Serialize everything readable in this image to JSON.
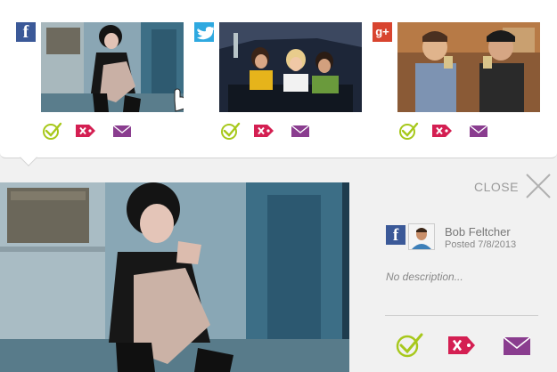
{
  "colors": {
    "accept": "#a7c81b",
    "reject": "#d41f52",
    "email": "#8a3d8f",
    "facebook": "#3b5998",
    "twitter": "#2fa9e0",
    "google_plus": "#d8442f"
  },
  "posts": [
    {
      "network_icon": "facebook-icon",
      "network_glyph": "f",
      "actions": [
        "check-icon",
        "reject-tag-icon",
        "mail-icon"
      ]
    },
    {
      "network_icon": "twitter-icon",
      "network_glyph": "t",
      "actions": [
        "check-icon",
        "reject-tag-icon",
        "mail-icon"
      ]
    },
    {
      "network_icon": "google-plus-icon",
      "network_glyph": "g+",
      "actions": [
        "check-icon",
        "reject-tag-icon",
        "mail-icon"
      ]
    }
  ],
  "detail": {
    "close_label": "CLOSE",
    "network_glyph": "f",
    "user_name": "Bob Feltcher",
    "posted": "Posted 7/8/2013",
    "description": "No description..."
  }
}
